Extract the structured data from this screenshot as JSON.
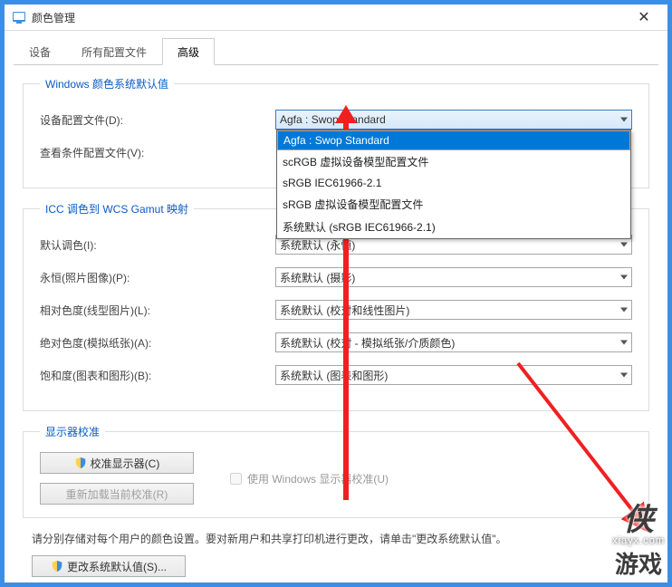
{
  "window": {
    "title": "颜色管理"
  },
  "tabs": {
    "t0": "设备",
    "t1": "所有配置文件",
    "t2": "高级"
  },
  "group1": {
    "legend": "Windows 颜色系统默认值",
    "device_profile_label": "设备配置文件(D):",
    "device_profile_value": "Agfa : Swop Standard",
    "device_profile_options": {
      "o0": "Agfa : Swop Standard",
      "o1": "scRGB 虚拟设备模型配置文件",
      "o2": "sRGB IEC61966-2.1",
      "o3": "sRGB 虚拟设备模型配置文件",
      "o4": "系统默认 (sRGB IEC61966-2.1)"
    },
    "viewing_conditions_label": "查看条件配置文件(V):"
  },
  "group2": {
    "legend": "ICC 调色到 WCS Gamut 映射",
    "default_rendering_label": "默认调色(I):",
    "default_rendering_value": "系统默认 (永恒)",
    "perceptual_label": "永恒(照片图像)(P):",
    "perceptual_value": "系统默认 (摄影)",
    "relative_label": "相对色度(线型图片)(L):",
    "relative_value": "系统默认 (校对和线性图片)",
    "absolute_label": "绝对色度(模拟纸张)(A):",
    "absolute_value": "系统默认 (校对 - 模拟纸张/介质颜色)",
    "saturation_label": "饱和度(图表和图形)(B):",
    "saturation_value": "系统默认 (图表和图形)"
  },
  "group3": {
    "legend": "显示器校准",
    "calibrate_btn": "校准显示器(C)",
    "reload_btn": "重新加载当前校准(R)",
    "use_wincal": "使用 Windows 显示器校准(U)"
  },
  "note": "请分别存储对每个用户的颜色设置。要对新用户和共享打印机进行更改，请单击\"更改系统默认值\"。",
  "change_defaults_btn": "更改系统默认值(S)...",
  "watermark": {
    "big": "侠",
    "url": "xiayx.com",
    "cn": "游戏"
  }
}
